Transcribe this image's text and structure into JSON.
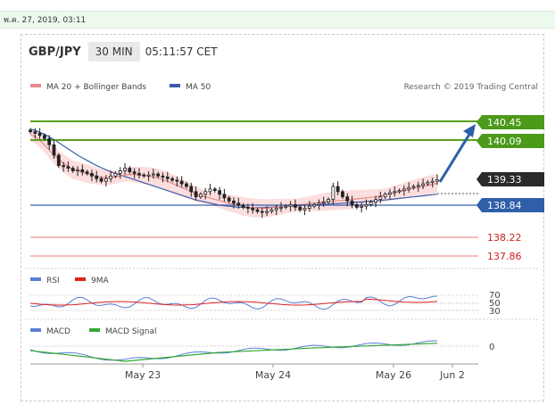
{
  "timestamp": "พ.ค. 27, 2019, 03:11",
  "header": {
    "pair": "GBP/JPY",
    "timeframe": "30 MIN",
    "time": "05:11:57 CET"
  },
  "legend": {
    "items": [
      {
        "label": "MA 20 + Bollinger Bands",
        "color": "#e98a8a"
      },
      {
        "label": "MA 50",
        "color": "#3b5ba9"
      }
    ],
    "credit": "Research © 2019 Trading Central"
  },
  "levels": [
    {
      "value": "140.45",
      "style": "green-badge"
    },
    {
      "value": "140.09",
      "style": "green-badge"
    },
    {
      "value": "139.33",
      "style": "dark-badge"
    },
    {
      "value": "138.84",
      "style": "blue-badge"
    },
    {
      "value": "138.22",
      "style": "red-text"
    },
    {
      "value": "137.86",
      "style": "red-text"
    }
  ],
  "rsi": {
    "legend": [
      "RSI",
      "9MA"
    ],
    "colors": [
      "#5b7fd6",
      "#dd2222"
    ],
    "ticks": [
      "70",
      "50",
      "30"
    ]
  },
  "macd": {
    "legend": [
      "MACD",
      "MACD Signal"
    ],
    "colors": [
      "#5b7fd6",
      "#33aa33"
    ],
    "ticks": [
      "0"
    ]
  },
  "xaxis": {
    "labels": [
      "May 23",
      "May 24",
      "May 26",
      "Jun 2"
    ]
  },
  "chart_data": {
    "type": "candlestick",
    "symbol": "GBP/JPY",
    "timeframe": "30 MIN",
    "resistance": [
      140.45,
      140.09
    ],
    "pivot": 139.33,
    "support": [
      138.84,
      138.22,
      137.86
    ],
    "ylim": [
      137.7,
      140.6
    ],
    "close": [
      140.25,
      140.22,
      140.18,
      140.12,
      140.0,
      139.8,
      139.6,
      139.58,
      139.55,
      139.5,
      139.52,
      139.48,
      139.45,
      139.4,
      139.35,
      139.3,
      139.35,
      139.4,
      139.45,
      139.5,
      139.55,
      139.48,
      139.45,
      139.42,
      139.4,
      139.42,
      139.44,
      139.4,
      139.38,
      139.35,
      139.32,
      139.3,
      139.25,
      139.2,
      139.1,
      139.0,
      139.05,
      139.1,
      139.15,
      139.12,
      139.05,
      138.98,
      138.92,
      138.88,
      138.84,
      138.8,
      138.78,
      138.75,
      138.72,
      138.7,
      138.72,
      138.75,
      138.78,
      138.8,
      138.82,
      138.85,
      138.8,
      138.75,
      138.78,
      138.82,
      138.85,
      138.88,
      138.9,
      138.95,
      139.2,
      139.1,
      139.0,
      138.92,
      138.85,
      138.8,
      138.82,
      138.85,
      138.9,
      138.95,
      139.0,
      139.05,
      139.08,
      139.1,
      139.12,
      139.15,
      139.18,
      139.2,
      139.22,
      139.25,
      139.28,
      139.3,
      139.33
    ],
    "ma20": [
      140.2,
      140.15,
      140.08,
      140.0,
      139.9,
      139.8,
      139.72,
      139.65,
      139.58,
      139.52,
      139.5,
      139.47,
      139.44,
      139.42,
      139.4,
      139.38,
      139.37,
      139.37,
      139.38,
      139.4,
      139.42,
      139.43,
      139.43,
      139.42,
      139.41,
      139.4,
      139.38,
      139.36,
      139.33,
      139.3,
      139.26,
      139.22,
      139.18,
      139.14,
      139.1,
      139.05,
      139.02,
      139.0,
      138.98,
      138.95,
      138.93,
      138.9,
      138.88,
      138.86,
      138.84,
      138.82,
      138.8,
      138.79,
      138.78,
      138.78,
      138.78,
      138.79,
      138.8,
      138.81,
      138.82,
      138.83,
      138.84,
      138.85,
      138.86,
      138.87,
      138.88,
      138.89,
      138.9,
      138.91,
      138.92,
      138.93,
      138.93,
      138.94,
      138.95,
      138.96,
      138.97,
      138.98,
      138.99,
      139.0,
      139.02,
      139.04,
      139.06,
      139.08,
      139.1,
      139.12,
      139.14,
      139.16,
      139.18,
      139.2,
      139.22,
      139.24,
      139.26
    ],
    "ma50": [
      140.3,
      140.28,
      140.24,
      140.2,
      140.15,
      140.1,
      140.04,
      139.98,
      139.92,
      139.86,
      139.8,
      139.75,
      139.7,
      139.65,
      139.6,
      139.56,
      139.52,
      139.48,
      139.45,
      139.42,
      139.39,
      139.36,
      139.33,
      139.3,
      139.27,
      139.24,
      139.21,
      139.18,
      139.15,
      139.12,
      139.09,
      139.06,
      139.03,
      139.0,
      138.97,
      138.94,
      138.92,
      138.9,
      138.88,
      138.86,
      138.84,
      138.83,
      138.82,
      138.81,
      138.8,
      138.8,
      138.79,
      138.79,
      138.79,
      138.79,
      138.8,
      138.8,
      138.81,
      138.81,
      138.82,
      138.82,
      138.83,
      138.83,
      138.84,
      138.84,
      138.85,
      138.85,
      138.86,
      138.86,
      138.87,
      138.87,
      138.88,
      138.88,
      138.89,
      138.9,
      138.9,
      138.91,
      138.92,
      138.92,
      138.93,
      138.94,
      138.95,
      138.96,
      138.97,
      138.98,
      138.99,
      139.0,
      139.01,
      139.02,
      139.03,
      139.04,
      139.05
    ]
  }
}
